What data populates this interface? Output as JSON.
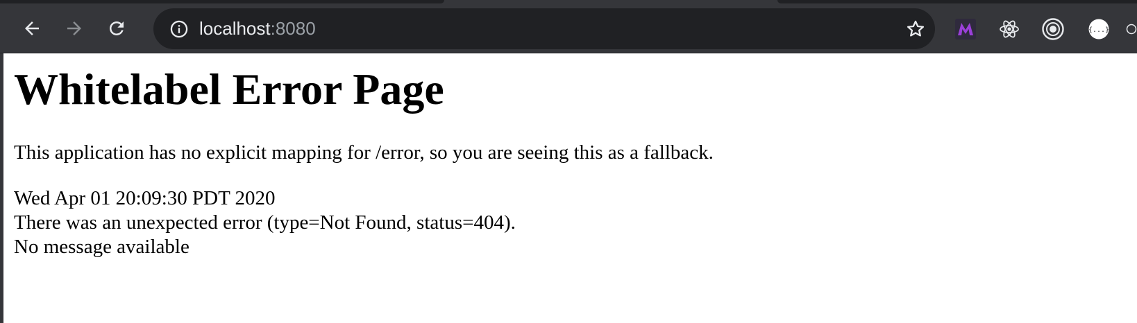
{
  "browser": {
    "address_bar": {
      "host": "localhost",
      "port": ":8080"
    },
    "icons": {
      "back": "back-arrow-icon",
      "forward": "forward-arrow-icon",
      "reload": "reload-icon",
      "site_info": "info-icon",
      "bookmark": "star-icon"
    },
    "extensions": [
      {
        "name": "metamask-like-m-extension-icon",
        "color": "#9b40d9"
      },
      {
        "name": "react-devtools-icon",
        "color": "#e8eaed"
      },
      {
        "name": "target-circle-extension-icon",
        "color": "#e8eaed"
      },
      {
        "name": "json-formatter-icon",
        "color": "#ffffff"
      }
    ],
    "colors": {
      "toolbar": "#35363a",
      "omnibox": "#202124",
      "icon": "#e8eaed",
      "icon_disabled": "#8a8d91"
    }
  },
  "page": {
    "title": "Whitelabel Error Page",
    "explanation": "This application has no explicit mapping for /error, so you are seeing this as a fallback.",
    "timestamp": "Wed Apr 01 20:09:30 PDT 2020",
    "error_line": "There was an unexpected error (type=Not Found, status=404).",
    "message": "No message available"
  }
}
